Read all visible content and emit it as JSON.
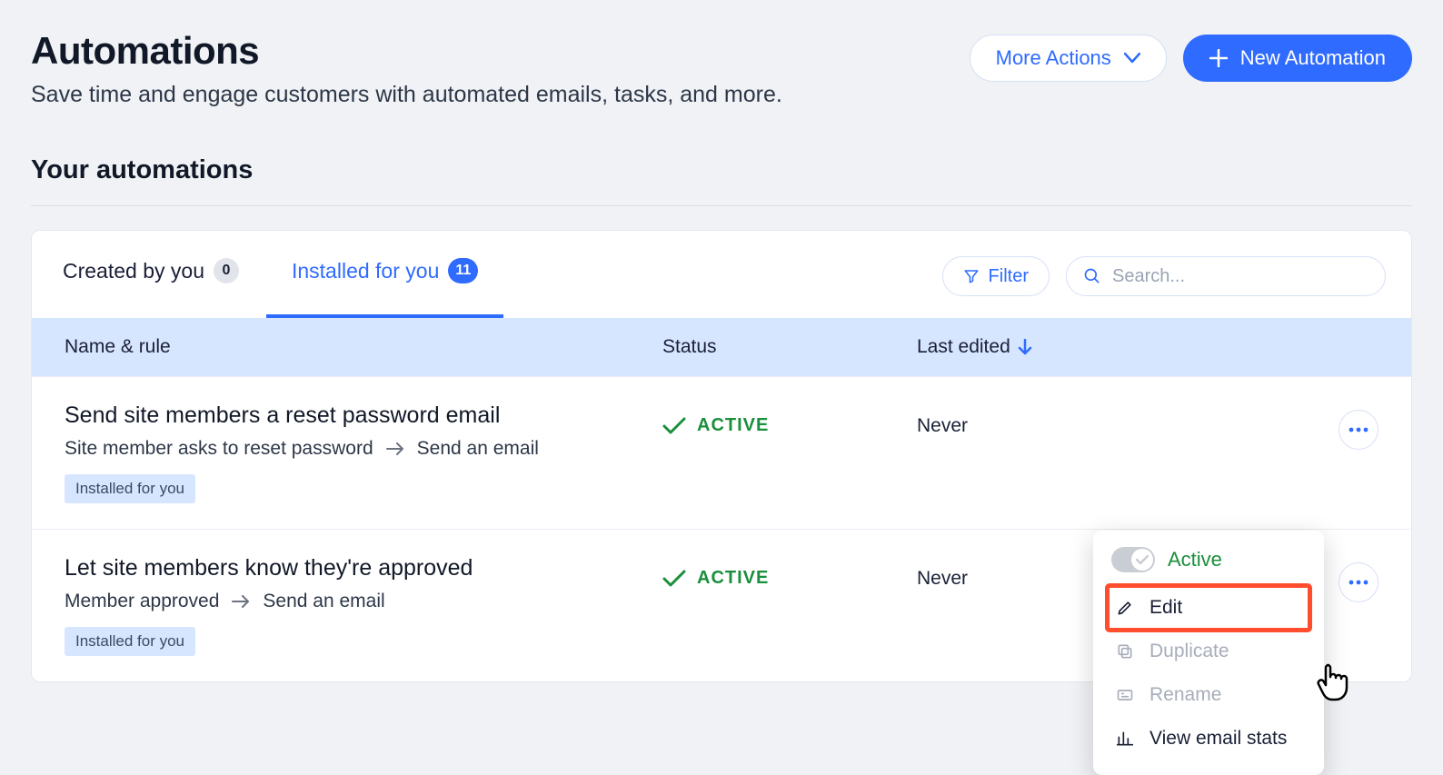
{
  "header": {
    "title": "Automations",
    "subtitle": "Save time and engage customers with automated emails, tasks, and more.",
    "more_actions_label": "More Actions",
    "new_automation_label": "New Automation"
  },
  "section_title": "Your automations",
  "tabs": {
    "created": {
      "label": "Created by you",
      "count": "0",
      "active": false
    },
    "installed": {
      "label": "Installed for you",
      "count": "11",
      "active": true
    }
  },
  "toolbar": {
    "filter_label": "Filter",
    "search_placeholder": "Search..."
  },
  "columns": {
    "name": "Name & rule",
    "status": "Status",
    "last_edited": "Last edited"
  },
  "rows": [
    {
      "title": "Send site members a reset password email",
      "rule_trigger": "Site member asks to reset password",
      "rule_action": "Send an email",
      "status_text": "ACTIVE",
      "last_edited": "Never",
      "badge": "Installed for you"
    },
    {
      "title": "Let site members know they're approved",
      "rule_trigger": "Member approved",
      "rule_action": "Send an email",
      "status_text": "ACTIVE",
      "last_edited": "Never",
      "badge": "Installed for you"
    }
  ],
  "context_menu": {
    "active_label": "Active",
    "edit": "Edit",
    "duplicate": "Duplicate",
    "rename": "Rename",
    "view_stats": "View email stats"
  },
  "colors": {
    "primary": "#2f6bff",
    "success": "#1a8f3c",
    "header_bg": "#d7e6ff",
    "highlight": "#ff4d2e"
  }
}
